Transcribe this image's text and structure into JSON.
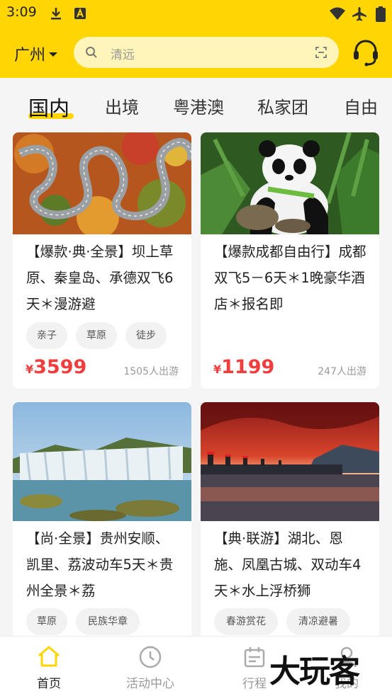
{
  "status_bar": {
    "time": "3:09"
  },
  "header": {
    "city": "广州",
    "search_placeholder": "清远"
  },
  "tabs": [
    {
      "label": "国内",
      "active": true
    },
    {
      "label": "出境"
    },
    {
      "label": "粤港澳"
    },
    {
      "label": "私家团"
    },
    {
      "label": "自由"
    }
  ],
  "products": [
    {
      "title": "【爆款·典·全景】坝上草原、秦皇岛、承德双飞6天＊漫游避",
      "tags": [
        "亲子",
        "草原",
        "徒步"
      ],
      "currency": "¥",
      "price": "3599",
      "sold": "1505人出游"
    },
    {
      "title": "【爆款成都自由行】成都双飞5－6天＊1晚豪华酒店＊报名即",
      "tags": [],
      "currency": "¥",
      "price": "1199",
      "sold": "247人出游"
    },
    {
      "title": "【尚·全景】贵州安顺、凯里、荔波动车5天＊贵州全景＊荔",
      "tags": [
        "草原",
        "民族华章"
      ]
    },
    {
      "title": "【典·联游】湖北、恩施、凤凰古城、双动车4天＊水上浮桥狮",
      "tags": [
        "春游赏花",
        "清凉避暑"
      ]
    }
  ],
  "bottom_nav": [
    {
      "label": "首页",
      "icon": "home-icon",
      "active": true
    },
    {
      "label": "活动中心",
      "icon": "clock-icon"
    },
    {
      "label": "行程",
      "icon": "calendar-icon"
    },
    {
      "label": "我的",
      "icon": "user-icon"
    }
  ],
  "watermark": "大玩客",
  "colors": {
    "brand_yellow": "#ffd503",
    "price_red": "#f23d3d"
  }
}
